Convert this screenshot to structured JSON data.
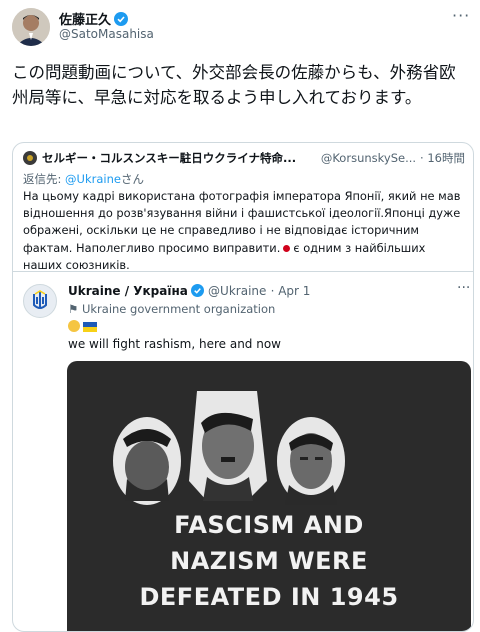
{
  "author": {
    "name": "佐藤正久",
    "handle": "@SatoMasahisa"
  },
  "tweet": {
    "text": "この問題動画について、外交部会長の佐藤からも、外務省欧州局等に、早急に対応を取るよう申し入れております。"
  },
  "quoted": {
    "name": "セルギー・コルスンスキー駐日ウクライナ特命...",
    "handle": "@KorsunskySe...",
    "time": "· 16時間",
    "reply_prefix": "返信先: ",
    "reply_to": "@Ukraine",
    "reply_suffix": "さん",
    "text_part1": "На цьому кадрі використана фотографія імператора Японії, який не мав відношення до розв'язування війни і фашистської ідеології.Японці дуже ображені, оскільки це не справедливо і не відповідає історичним фактам. Наполегливо просимо виправити.",
    "text_part2": "є одним з найбільших наших союзників."
  },
  "inner_post": {
    "name": "Ukraine / Україна",
    "handle": "@Ukraine",
    "date": "· Apr 1",
    "org_label": "Ukraine government organization",
    "text": "we will fight rashism, here and now",
    "media_caption_lines": [
      "FASCISM AND",
      "NAZISM WERE",
      "DEFEATED IN 1945"
    ]
  },
  "colors": {
    "link": "#1d9bf0",
    "secondary": "#536471",
    "verified": "#1d9bf0",
    "border": "#cfd9de"
  }
}
